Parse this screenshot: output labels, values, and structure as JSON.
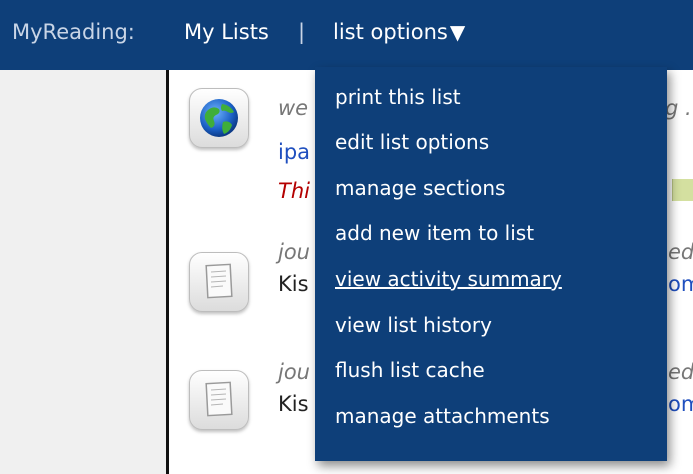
{
  "topbar": {
    "brand": "MyReading:",
    "my_lists": "My Lists",
    "separator": "|",
    "list_options": "list options",
    "caret": "▼"
  },
  "rows": [
    {
      "icon": "globe-icon",
      "line1": "we",
      "line1_right": "g .",
      "line2": "ipa",
      "line3": "Thi"
    },
    {
      "icon": "document-icon",
      "line1": "jou",
      "line1_right": "ed",
      "line2": "Kis",
      "line2_right": "om"
    },
    {
      "icon": "document-icon",
      "line1": "jou",
      "line1_right": "ed",
      "line2": "Kis",
      "line2_right": "om"
    }
  ],
  "menu": {
    "items": [
      "print this list",
      "edit list options",
      "manage sections",
      "add new item to list",
      "view activity summary",
      "view list history",
      "flush list cache",
      "manage attachments"
    ]
  },
  "colors": {
    "bar": "#0e3f79",
    "menu": "#0e3f79",
    "link": "#1f4fbf",
    "accent_red": "#b40000"
  }
}
